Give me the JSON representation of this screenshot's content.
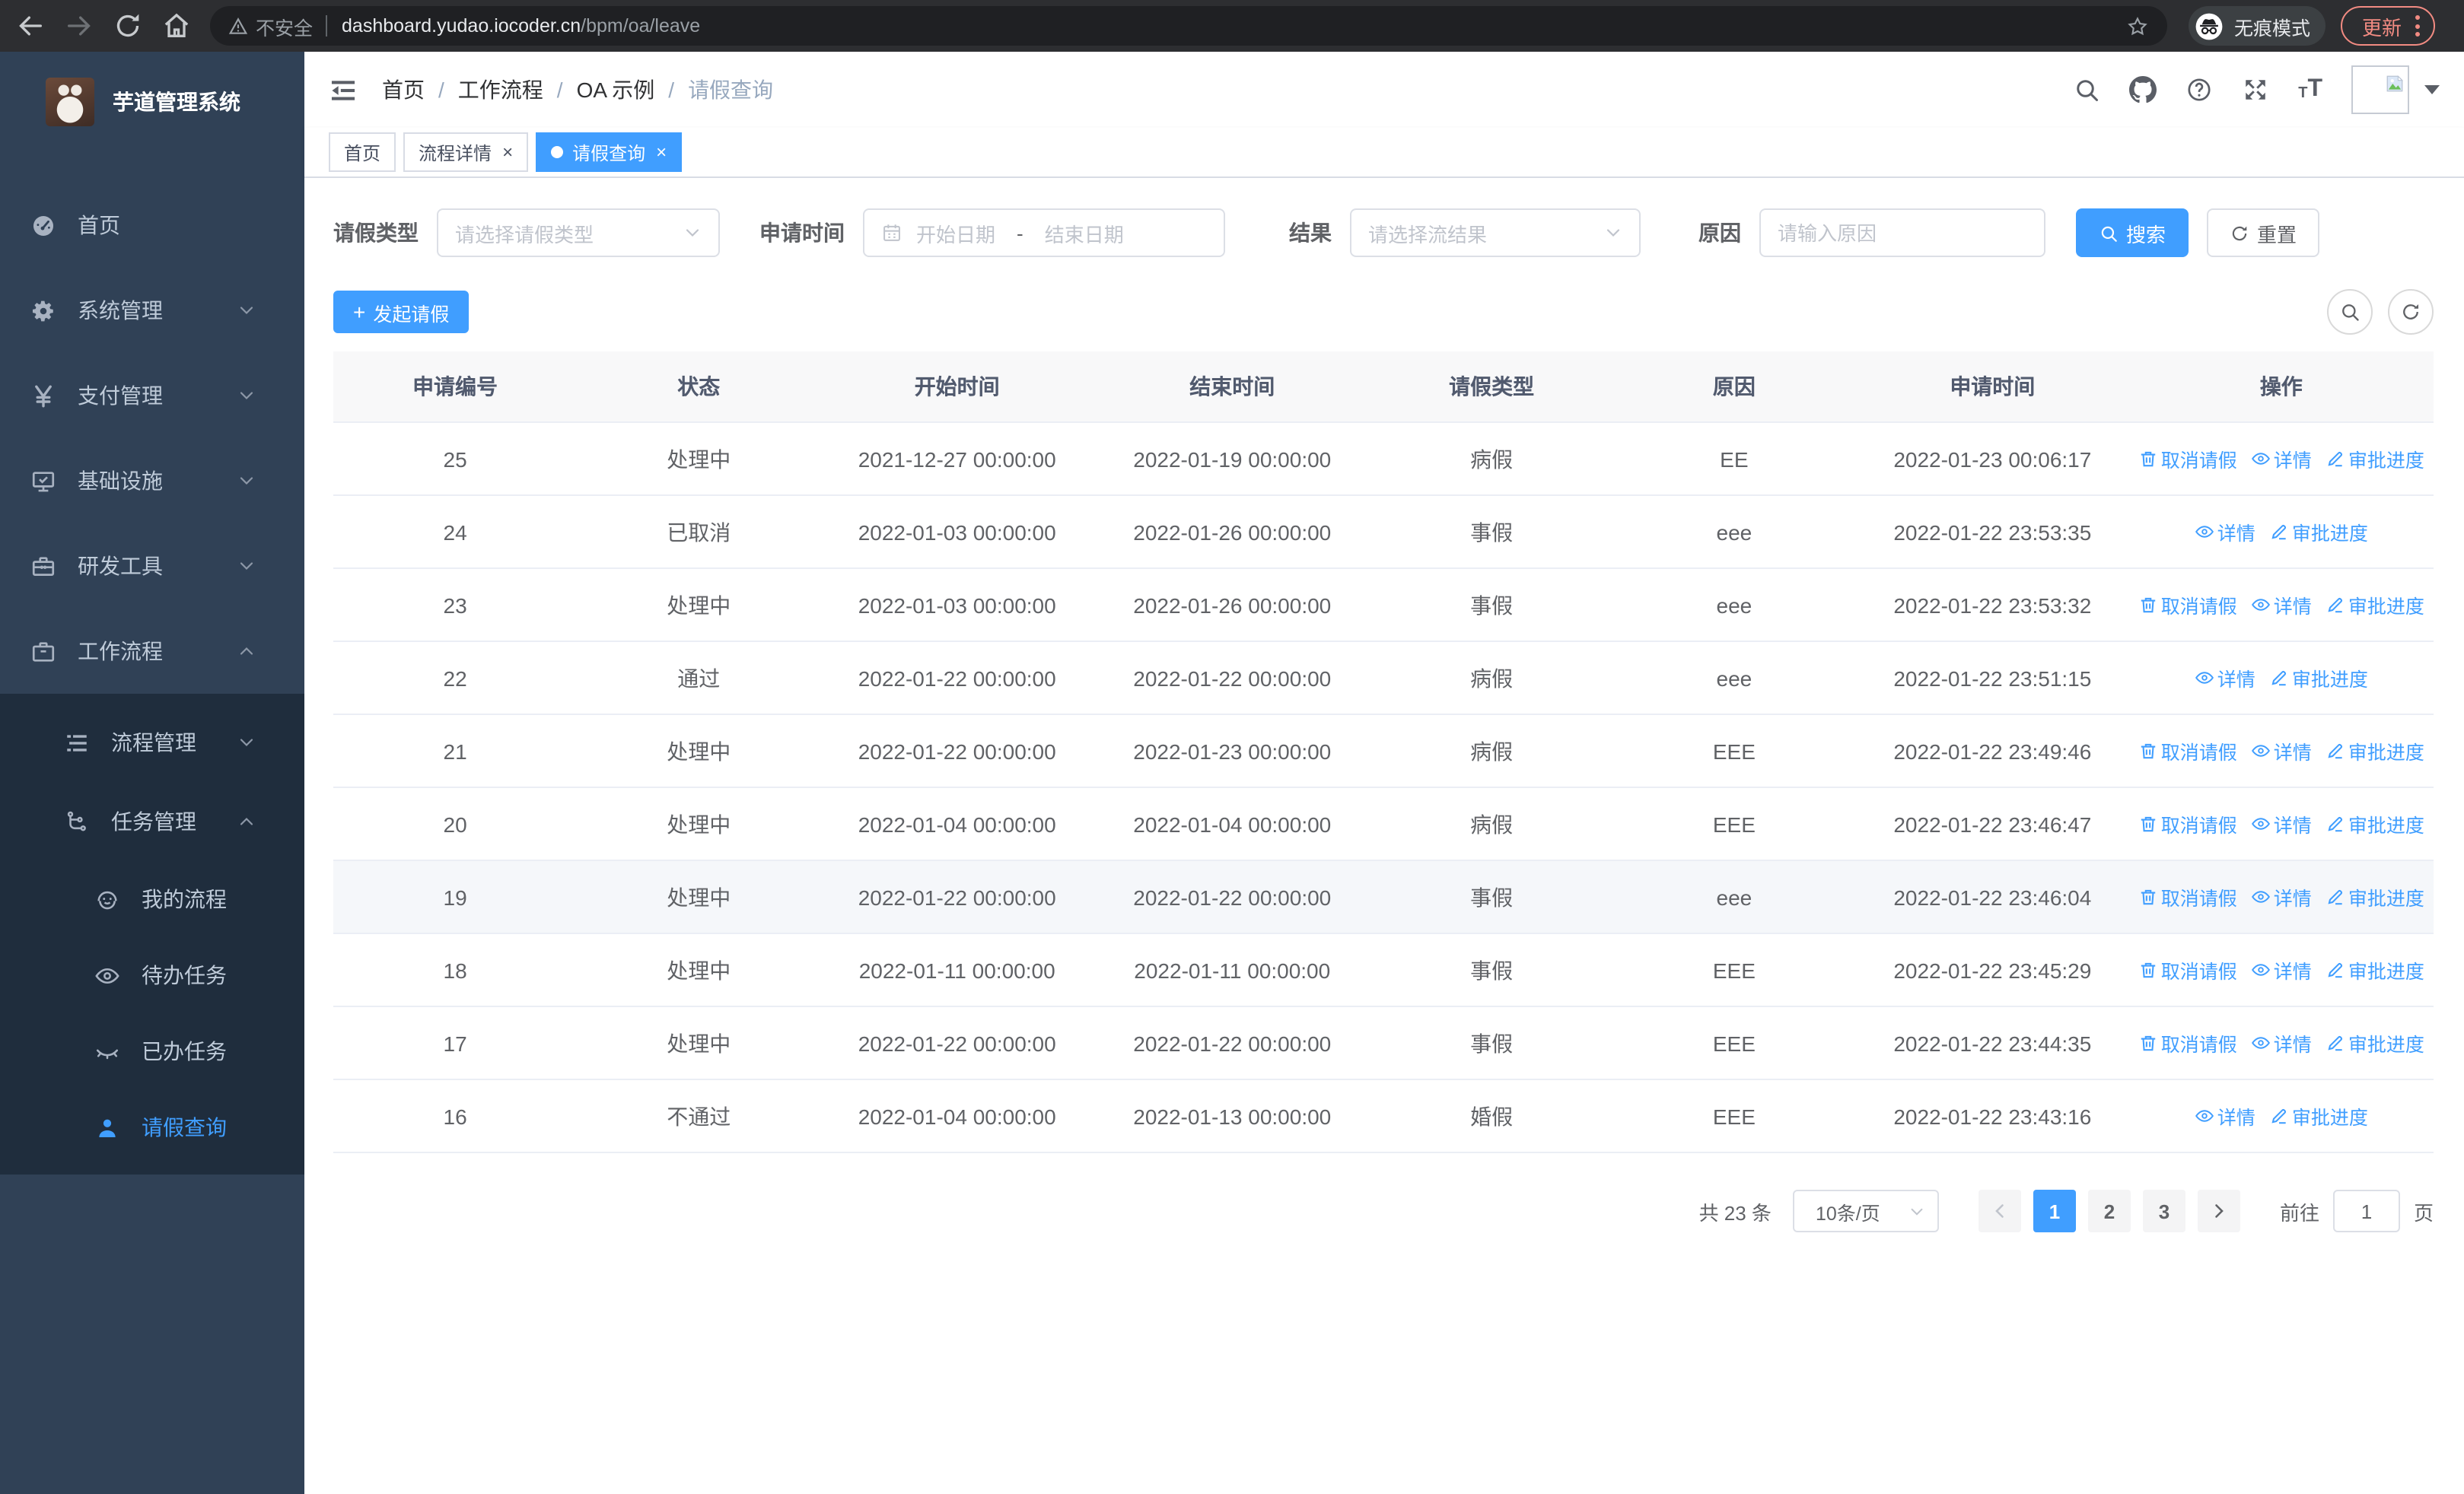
{
  "browser": {
    "security_warning": "不安全",
    "url_host": "dashboard.yudao.iocoder.cn",
    "url_path": "/bpm/oa/leave",
    "incognito_label": "无痕模式",
    "update_label": "更新"
  },
  "colors": {
    "accent": "#409eff",
    "sidebar_bg": "#304156",
    "submenu_bg": "#1f2d3d",
    "update_red": "#f28b82",
    "row_highlight": "#f5f7fa"
  },
  "sidebar": {
    "logo_title": "芋道管理系统",
    "menu": [
      {
        "key": "home",
        "label": "首页",
        "icon": "dashboard-icon",
        "level": 1
      },
      {
        "key": "system",
        "label": "系统管理",
        "icon": "gear-icon",
        "level": 1,
        "chevron": "down"
      },
      {
        "key": "payment",
        "label": "支付管理",
        "icon": "yen-icon",
        "level": 1,
        "chevron": "down"
      },
      {
        "key": "infra",
        "label": "基础设施",
        "icon": "monitor-icon",
        "level": 1,
        "chevron": "down"
      },
      {
        "key": "devtools",
        "label": "研发工具",
        "icon": "toolbox-icon",
        "level": 1,
        "chevron": "down"
      },
      {
        "key": "workflow",
        "label": "工作流程",
        "icon": "briefcase-icon",
        "level": 1,
        "chevron": "up"
      },
      {
        "key": "process-mgmt",
        "label": "流程管理",
        "icon": "list-icon",
        "level": 2,
        "chevron": "down",
        "group": true
      },
      {
        "key": "task-mgmt",
        "label": "任务管理",
        "icon": "flow-icon",
        "level": 2,
        "chevron": "up",
        "group": true
      },
      {
        "key": "my-process",
        "label": "我的流程",
        "icon": "robot-face-icon",
        "level": 3,
        "group": true
      },
      {
        "key": "todo-task",
        "label": "待办任务",
        "icon": "eye-icon",
        "level": 3,
        "group": true
      },
      {
        "key": "done-task",
        "label": "已办任务",
        "icon": "eye-closed-icon",
        "level": 3,
        "group": true
      },
      {
        "key": "leave-query",
        "label": "请假查询",
        "icon": "user-icon",
        "level": 3,
        "group": true,
        "active": true
      }
    ]
  },
  "header": {
    "breadcrumb": [
      "首页",
      "工作流程",
      "OA 示例",
      "请假查询"
    ],
    "tabs": [
      {
        "key": "home",
        "label": "首页",
        "closable": false,
        "active": false
      },
      {
        "key": "process-detail",
        "label": "流程详情",
        "closable": true,
        "active": false
      },
      {
        "key": "leave-query",
        "label": "请假查询",
        "closable": true,
        "active": true
      }
    ]
  },
  "filters": {
    "leave_type_label": "请假类型",
    "leave_type_placeholder": "请选择请假类型",
    "apply_time_label": "申请时间",
    "date_start_placeholder": "开始日期",
    "date_separator": "-",
    "date_end_placeholder": "结束日期",
    "result_label": "结果",
    "result_placeholder": "请选择流结果",
    "reason_label": "原因",
    "reason_placeholder": "请输入原因",
    "search_label": "搜索",
    "reset_label": "重置"
  },
  "toolbar": {
    "create_label": "发起请假"
  },
  "table": {
    "headers": [
      "申请编号",
      "状态",
      "开始时间",
      "结束时间",
      "请假类型",
      "原因",
      "申请时间",
      "操作"
    ],
    "action_defs": {
      "cancel": {
        "label": "取消请假",
        "icon": "trash-icon"
      },
      "detail": {
        "label": "详情",
        "icon": "eye-icon"
      },
      "progress": {
        "label": "审批进度",
        "icon": "edit-icon"
      }
    },
    "rows": [
      {
        "id": "25",
        "status": "处理中",
        "start": "2021-12-27 00:00:00",
        "end": "2022-01-19 00:00:00",
        "type": "病假",
        "reason": "EE",
        "applied": "2022-01-23 00:06:17",
        "highlight": false,
        "actions": [
          "cancel",
          "detail",
          "progress"
        ]
      },
      {
        "id": "24",
        "status": "已取消",
        "start": "2022-01-03 00:00:00",
        "end": "2022-01-26 00:00:00",
        "type": "事假",
        "reason": "eee",
        "applied": "2022-01-22 23:53:35",
        "highlight": false,
        "actions": [
          "detail",
          "progress"
        ]
      },
      {
        "id": "23",
        "status": "处理中",
        "start": "2022-01-03 00:00:00",
        "end": "2022-01-26 00:00:00",
        "type": "事假",
        "reason": "eee",
        "applied": "2022-01-22 23:53:32",
        "highlight": false,
        "actions": [
          "cancel",
          "detail",
          "progress"
        ]
      },
      {
        "id": "22",
        "status": "通过",
        "start": "2022-01-22 00:00:00",
        "end": "2022-01-22 00:00:00",
        "type": "病假",
        "reason": "eee",
        "applied": "2022-01-22 23:51:15",
        "highlight": false,
        "actions": [
          "detail",
          "progress"
        ]
      },
      {
        "id": "21",
        "status": "处理中",
        "start": "2022-01-22 00:00:00",
        "end": "2022-01-23 00:00:00",
        "type": "病假",
        "reason": "EEE",
        "applied": "2022-01-22 23:49:46",
        "highlight": false,
        "actions": [
          "cancel",
          "detail",
          "progress"
        ]
      },
      {
        "id": "20",
        "status": "处理中",
        "start": "2022-01-04 00:00:00",
        "end": "2022-01-04 00:00:00",
        "type": "病假",
        "reason": "EEE",
        "applied": "2022-01-22 23:46:47",
        "highlight": false,
        "actions": [
          "cancel",
          "detail",
          "progress"
        ]
      },
      {
        "id": "19",
        "status": "处理中",
        "start": "2022-01-22 00:00:00",
        "end": "2022-01-22 00:00:00",
        "type": "事假",
        "reason": "eee",
        "applied": "2022-01-22 23:46:04",
        "highlight": true,
        "actions": [
          "cancel",
          "detail",
          "progress"
        ]
      },
      {
        "id": "18",
        "status": "处理中",
        "start": "2022-01-11 00:00:00",
        "end": "2022-01-11 00:00:00",
        "type": "事假",
        "reason": "EEE",
        "applied": "2022-01-22 23:45:29",
        "highlight": false,
        "actions": [
          "cancel",
          "detail",
          "progress"
        ]
      },
      {
        "id": "17",
        "status": "处理中",
        "start": "2022-01-22 00:00:00",
        "end": "2022-01-22 00:00:00",
        "type": "事假",
        "reason": "EEE",
        "applied": "2022-01-22 23:44:35",
        "highlight": false,
        "actions": [
          "cancel",
          "detail",
          "progress"
        ]
      },
      {
        "id": "16",
        "status": "不通过",
        "start": "2022-01-04 00:00:00",
        "end": "2022-01-13 00:00:00",
        "type": "婚假",
        "reason": "EEE",
        "applied": "2022-01-22 23:43:16",
        "highlight": false,
        "actions": [
          "detail",
          "progress"
        ]
      }
    ]
  },
  "pagination": {
    "total_text": "共 23 条",
    "page_size": "10条/页",
    "pages": [
      "1",
      "2",
      "3"
    ],
    "active_page": "1",
    "goto_label": "前往",
    "goto_value": "1",
    "goto_suffix": "页"
  }
}
